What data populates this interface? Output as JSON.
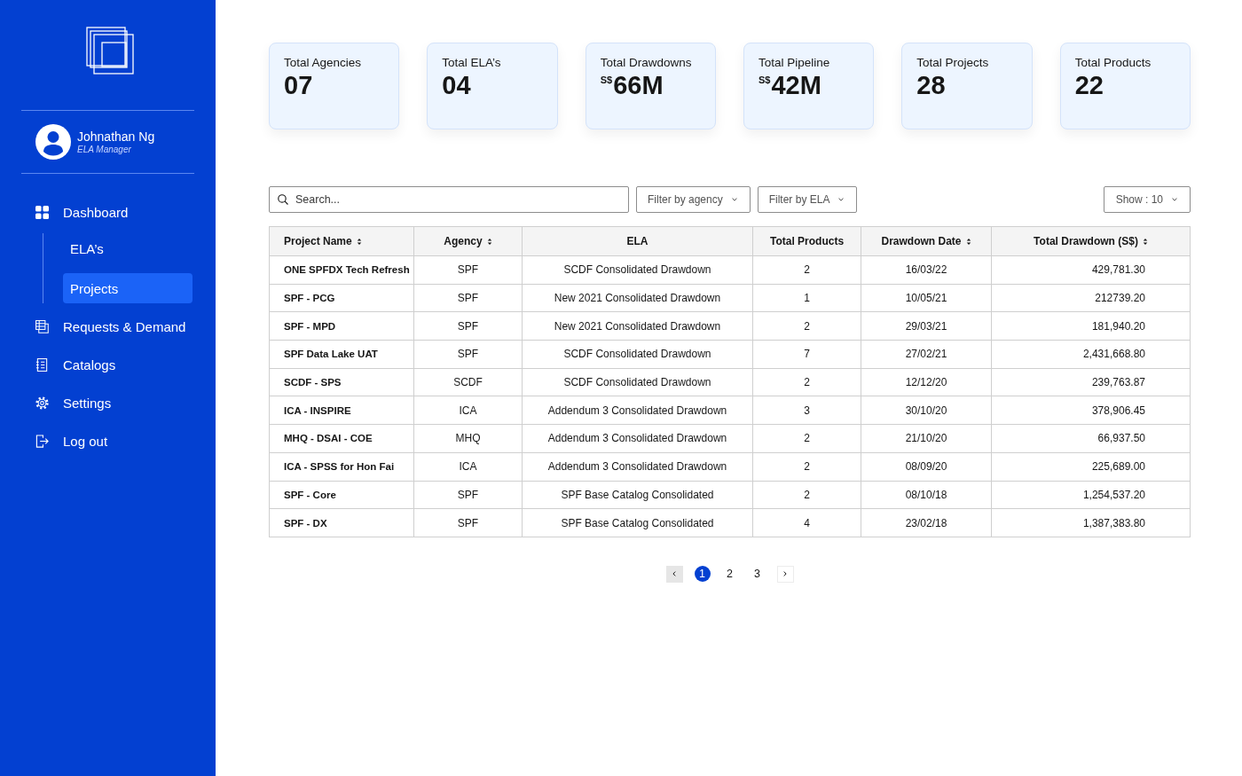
{
  "sidebar": {
    "user": {
      "name": "Johnathan Ng",
      "role": "ELA Manager"
    },
    "nav": [
      {
        "label": "Dashboard",
        "selected": false,
        "children": [
          {
            "label": "ELA’s",
            "selected": false
          },
          {
            "label": "Projects",
            "selected": true
          }
        ]
      },
      {
        "label": "Requests & Demand",
        "selected": false
      },
      {
        "label": "Catalogs",
        "selected": false
      },
      {
        "label": "Settings",
        "selected": false
      },
      {
        "label": "Log out",
        "selected": false
      }
    ]
  },
  "stats": [
    {
      "label": "Total Agencies",
      "value": "07"
    },
    {
      "label": "Total ELA’s",
      "value": "04"
    },
    {
      "label": "Total Drawdowns",
      "prefix": "S$",
      "value": "66M"
    },
    {
      "label": "Total Pipeline",
      "prefix": "S$",
      "value": "42M"
    },
    {
      "label": "Total Projects",
      "value": "28"
    },
    {
      "label": "Total Products",
      "value": "22"
    }
  ],
  "toolbar": {
    "search": {
      "placeholder": "Search..."
    },
    "filters": [
      "Filter by agency",
      "Filter by ELA"
    ],
    "show": "Show : 10"
  },
  "table": {
    "columns": [
      {
        "label": "Project Name",
        "sortable": true
      },
      {
        "label": "Agency",
        "sortable": true
      },
      {
        "label": "ELA",
        "sortable": false
      },
      {
        "label": "Total Products",
        "sortable": false
      },
      {
        "label": "Drawdown Date",
        "sortable": true
      },
      {
        "label": "Total Drawdown (S$)",
        "sortable": true
      }
    ],
    "rows": [
      [
        "ONE SPFDX Tech Refresh",
        "SPF",
        "SCDF Consolidated Drawdown",
        "2",
        "16/03/22",
        "429,781.30"
      ],
      [
        "SPF - PCG",
        "SPF",
        "New 2021 Consolidated Drawdown",
        "1",
        "10/05/21",
        "212739.20"
      ],
      [
        "SPF - MPD",
        "SPF",
        "New 2021 Consolidated Drawdown",
        "2",
        "29/03/21",
        "181,940.20"
      ],
      [
        "SPF Data Lake UAT",
        "SPF",
        "SCDF Consolidated Drawdown",
        "7",
        "27/02/21",
        "2,431,668.80"
      ],
      [
        "SCDF - SPS",
        "SCDF",
        "SCDF Consolidated Drawdown",
        "2",
        "12/12/20",
        "239,763.87"
      ],
      [
        "ICA - INSPIRE",
        "ICA",
        "Addendum 3 Consolidated Drawdown",
        "3",
        "30/10/20",
        "378,906.45"
      ],
      [
        "MHQ - DSAI - COE",
        "MHQ",
        "Addendum 3 Consolidated Drawdown",
        "2",
        "21/10/20",
        "66,937.50"
      ],
      [
        "ICA - SPSS for Hon Fai",
        "ICA",
        "Addendum 3 Consolidated Drawdown",
        "2",
        "08/09/20",
        "225,689.00"
      ],
      [
        "SPF - Core",
        "SPF",
        "SPF Base Catalog Consolidated",
        "2",
        "08/10/18",
        "1,254,537.20"
      ],
      [
        "SPF - DX",
        "SPF",
        "SPF Base Catalog Consolidated",
        "4",
        "23/02/18",
        "1,387,383.80"
      ]
    ]
  },
  "pagination": {
    "previous": {
      "disabled": true
    },
    "pages": [
      {
        "label": "1",
        "selected": true
      },
      {
        "label": "2",
        "selected": false
      },
      {
        "label": "3",
        "selected": false
      }
    ],
    "next": {
      "disabled": false
    }
  }
}
